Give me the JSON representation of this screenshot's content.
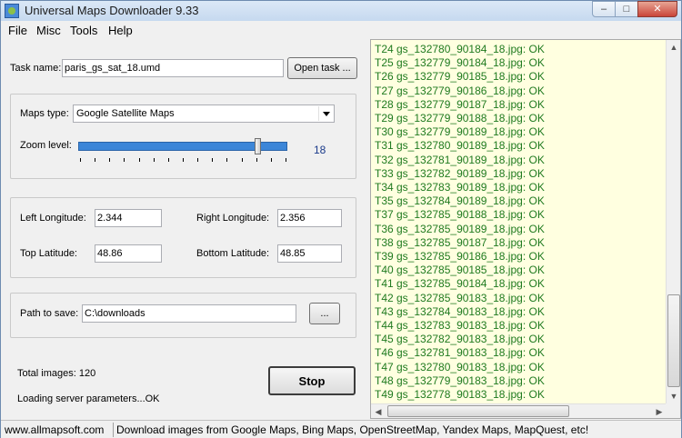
{
  "window": {
    "title": "Universal Maps Downloader 9.33",
    "min_glyph": "–",
    "max_glyph": "□",
    "close_glyph": "✕"
  },
  "menu": {
    "items": [
      "File",
      "Misc",
      "Tools",
      "Help"
    ]
  },
  "task": {
    "label": "Task name:",
    "value": "paris_gs_sat_18.umd",
    "open_button": "Open task ..."
  },
  "maps": {
    "type_label": "Maps type:",
    "type_value": "Google Satellite Maps",
    "zoom_label": "Zoom level:",
    "zoom_value": "18",
    "zoom_fraction": 0.9
  },
  "coords": {
    "left_lon_label": "Left Longitude:",
    "left_lon": "2.344",
    "right_lon_label": "Right Longitude:",
    "right_lon": "2.356",
    "top_lat_label": "Top Latitude:",
    "top_lat": "48.86",
    "bottom_lat_label": "Bottom Latitude:",
    "bottom_lat": "48.85"
  },
  "save": {
    "label": "Path to save:",
    "value": "C:\\downloads",
    "browse_button": "..."
  },
  "status": {
    "total_images": "Total images: 120",
    "loading": "Loading server parameters...OK",
    "stop_button": "Stop"
  },
  "log": [
    "T24 gs_132780_90184_18.jpg: OK",
    "T25 gs_132779_90184_18.jpg: OK",
    "T26 gs_132779_90185_18.jpg: OK",
    "T27 gs_132779_90186_18.jpg: OK",
    "T28 gs_132779_90187_18.jpg: OK",
    "T29 gs_132779_90188_18.jpg: OK",
    "T30 gs_132779_90189_18.jpg: OK",
    "T31 gs_132780_90189_18.jpg: OK",
    "T32 gs_132781_90189_18.jpg: OK",
    "T33 gs_132782_90189_18.jpg: OK",
    "T34 gs_132783_90189_18.jpg: OK",
    "T35 gs_132784_90189_18.jpg: OK",
    "T37 gs_132785_90188_18.jpg: OK",
    "T36 gs_132785_90189_18.jpg: OK",
    "T38 gs_132785_90187_18.jpg: OK",
    "T39 gs_132785_90186_18.jpg: OK",
    "T40 gs_132785_90185_18.jpg: OK",
    "T41 gs_132785_90184_18.jpg: OK",
    "T42 gs_132785_90183_18.jpg: OK",
    "T43 gs_132784_90183_18.jpg: OK",
    "T44 gs_132783_90183_18.jpg: OK",
    "T45 gs_132782_90183_18.jpg: OK",
    "T46 gs_132781_90183_18.jpg: OK",
    "T47 gs_132780_90183_18.jpg: OK",
    "T48 gs_132779_90183_18.jpg: OK",
    "T49 gs_132778_90183_18.jpg: OK"
  ],
  "statusbar": {
    "site": "www.allmapsoft.com",
    "message": "Download images from Google Maps, Bing Maps, OpenStreetMap, Yandex Maps, MapQuest, etc!"
  },
  "colors": {
    "log_text": "#1f7a1f",
    "log_bg": "#ffffe0",
    "zoom_value": "#1a3a8a",
    "slider_fill": "#3c86d8"
  },
  "icons": [
    "app-icon",
    "dropdown-arrow-icon",
    "scroll-up-icon",
    "scroll-down-icon",
    "scroll-left-icon",
    "scroll-right-icon"
  ]
}
